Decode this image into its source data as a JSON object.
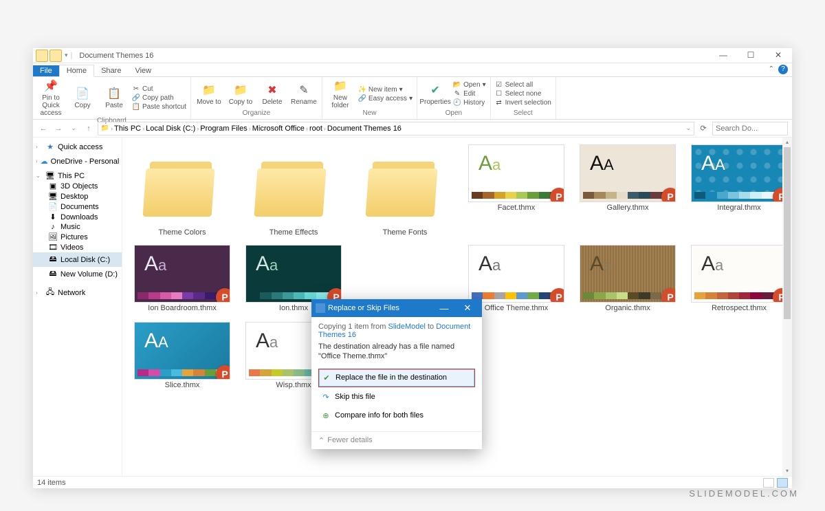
{
  "window": {
    "title": "Document Themes 16",
    "min": "—",
    "max": "☐",
    "close": "✕"
  },
  "tabs": {
    "file": "File",
    "home": "Home",
    "share": "Share",
    "view": "View"
  },
  "ribbon": {
    "pin": "Pin to Quick access",
    "copy": "Copy",
    "paste": "Paste",
    "cut": "Cut",
    "copypath": "Copy path",
    "pasteshortcut": "Paste shortcut",
    "clipboard_label": "Clipboard",
    "moveto": "Move to",
    "copyto": "Copy to",
    "delete": "Delete",
    "rename": "Rename",
    "organize_label": "Organize",
    "newfolder": "New folder",
    "newitem": "New item",
    "easyaccess": "Easy access",
    "new_label": "New",
    "properties": "Properties",
    "open": "Open",
    "edit": "Edit",
    "history": "History",
    "open_label": "Open",
    "selectall": "Select all",
    "selectnone": "Select none",
    "invert": "Invert selection",
    "select_label": "Select"
  },
  "breadcrumb": [
    "This PC",
    "Local Disk (C:)",
    "Program Files",
    "Microsoft Office",
    "root",
    "Document Themes 16"
  ],
  "search_placeholder": "Search Do...",
  "nav": {
    "quick": "Quick access",
    "onedrive": "OneDrive - Personal",
    "thispc": "This PC",
    "children": [
      "3D Objects",
      "Desktop",
      "Documents",
      "Downloads",
      "Music",
      "Pictures",
      "Videos",
      "Local Disk (C:)",
      "New Volume (D:)"
    ],
    "network": "Network"
  },
  "folders": [
    "Theme Colors",
    "Theme Effects",
    "Theme Fonts"
  ],
  "themes": [
    {
      "name": "Facet.thmx",
      "bg": "#ffffff",
      "fg1": "#6a9e3b",
      "fg2": "#a7c957",
      "swatches": [
        "#6a3b1e",
        "#a6662a",
        "#d6a22a",
        "#e8d24b",
        "#a7c957",
        "#6a9e3b",
        "#3b7a3b",
        "#2a5a2a"
      ]
    },
    {
      "name": "Gallery.thmx",
      "bg": "#ece5d8",
      "fg1": "#111",
      "fg2": "#111",
      "swatches": [
        "#7a5a3b",
        "#a6885a",
        "#c7b28a",
        "#e6dcc7",
        "#3b5a6a",
        "#2a4a5a",
        "#6a3b3b",
        "#3b3b3b"
      ],
      "photo": true
    },
    {
      "name": "Integral.thmx",
      "bg": "#1787b5",
      "fg1": "#fff",
      "fg2": "#fff",
      "swatches": [
        "#0e5a7a",
        "#1787b5",
        "#4aa8cc",
        "#7cc3dd",
        "#a8dceb",
        "#d0eef6",
        "#eaf7fb",
        "#ffffff"
      ],
      "pattern": true
    },
    {
      "name": "Ion Boardroom.thmx",
      "bg": "#4a2a4a",
      "fg1": "#e8e8f0",
      "fg2": "#c8b0d0",
      "swatches": [
        "#8a2a6a",
        "#b83a8a",
        "#d65aa8",
        "#e87ac0",
        "#7a3aa8",
        "#5a2a8a",
        "#3a1a6a",
        "#2a1a4a"
      ],
      "purple": true
    },
    {
      "name": "Ion.thmx",
      "bg": "#0a3a3a",
      "fg1": "#d0e8e0",
      "fg2": "#a0d0c0",
      "swatches": [
        "#0a3a3a",
        "#1a5a5a",
        "#2a7a7a",
        "#3a9a9a",
        "#4ababA",
        "#6adada",
        "#8aeaea",
        "#aafafa"
      ]
    },
    {
      "name": "Office Theme.thmx",
      "bg": "#ffffff",
      "fg1": "#333",
      "fg2": "#777",
      "swatches": [
        "#4472c4",
        "#ed7d31",
        "#a5a5a5",
        "#ffc000",
        "#5b9bd5",
        "#70ad47",
        "#264478",
        "#9e480e"
      ]
    },
    {
      "name": "Organic.thmx",
      "bg": "#f0ebe0",
      "fg1": "#5a4a2a",
      "fg2": "#8a7a5a",
      "swatches": [
        "#6a8a3a",
        "#8aa84a",
        "#a8c46a",
        "#c6de8a",
        "#5a4a2a",
        "#3a3a2a",
        "#7a6a4a",
        "#9a8a6a"
      ],
      "wood": true
    },
    {
      "name": "Retrospect.thmx",
      "bg": "#fdfcf8",
      "fg1": "#333",
      "fg2": "#888",
      "swatches": [
        "#e8a23a",
        "#d6833a",
        "#c4643a",
        "#b2453a",
        "#a0263a",
        "#8e073a",
        "#6a1a3a",
        "#4a2a3a"
      ]
    },
    {
      "name": "Slice.thmx",
      "bg": "linear-gradient(135deg,#2a9ec7,#1a7aa0)",
      "fg1": "#fff",
      "fg2": "#fff",
      "swatches": [
        "#b82a8a",
        "#d64aa8",
        "#2a9ec7",
        "#4abade",
        "#e8a23a",
        "#d6833a",
        "#6a9e3b",
        "#a7c957"
      ]
    },
    {
      "name": "Wisp.thmx",
      "bg": "#ffffff",
      "fg1": "#333",
      "fg2": "#888",
      "swatches": [
        "#e87a4a",
        "#d6a23a",
        "#c4ca2a",
        "#a8c46a",
        "#8abe8a",
        "#6ab8aa",
        "#4ab2ca",
        "#2a9ec7"
      ],
      "arrow": true
    }
  ],
  "dialog": {
    "title": "Replace or Skip Files",
    "line1_a": "Copying 1 item from ",
    "line1_b": "SlideModel",
    "line1_c": " to ",
    "line1_d": "Document Themes 16",
    "msg": "The destination already has a file named \"Office Theme.thmx\"",
    "opt_replace": "Replace the file in the destination",
    "opt_skip": "Skip this file",
    "opt_compare": "Compare info for both files",
    "fewer": "Fewer details"
  },
  "status": {
    "count": "14 items"
  },
  "icons": {
    "pin": "📌",
    "copy": "📄",
    "paste": "📋",
    "scissors": "✂",
    "link": "🔗",
    "move": "📁",
    "delete": "✖",
    "rename": "✎",
    "newfolder": "📁",
    "spark": "✨",
    "prop": "✔",
    "open": "📂",
    "edit": "✎",
    "history": "🕘",
    "selectall": "☑",
    "selectnone": "☐",
    "invert": "⇄",
    "star": "★",
    "cloud": "☁",
    "monitor": "🖥",
    "drive": "🖴",
    "net": "🖧",
    "cube": "▣",
    "desktop": "🖥",
    "doc": "📄",
    "down": "⬇",
    "music": "♪",
    "pic": "🖼",
    "vid": "🎞",
    "back": "←",
    "fwd": "→",
    "up": "↑",
    "refresh": "⟳",
    "chev": "⌄",
    "check": "✔",
    "skip": "↷",
    "compare": "⊕",
    "collapse": "⌃"
  },
  "watermark": "SLIDEMODEL.COM"
}
